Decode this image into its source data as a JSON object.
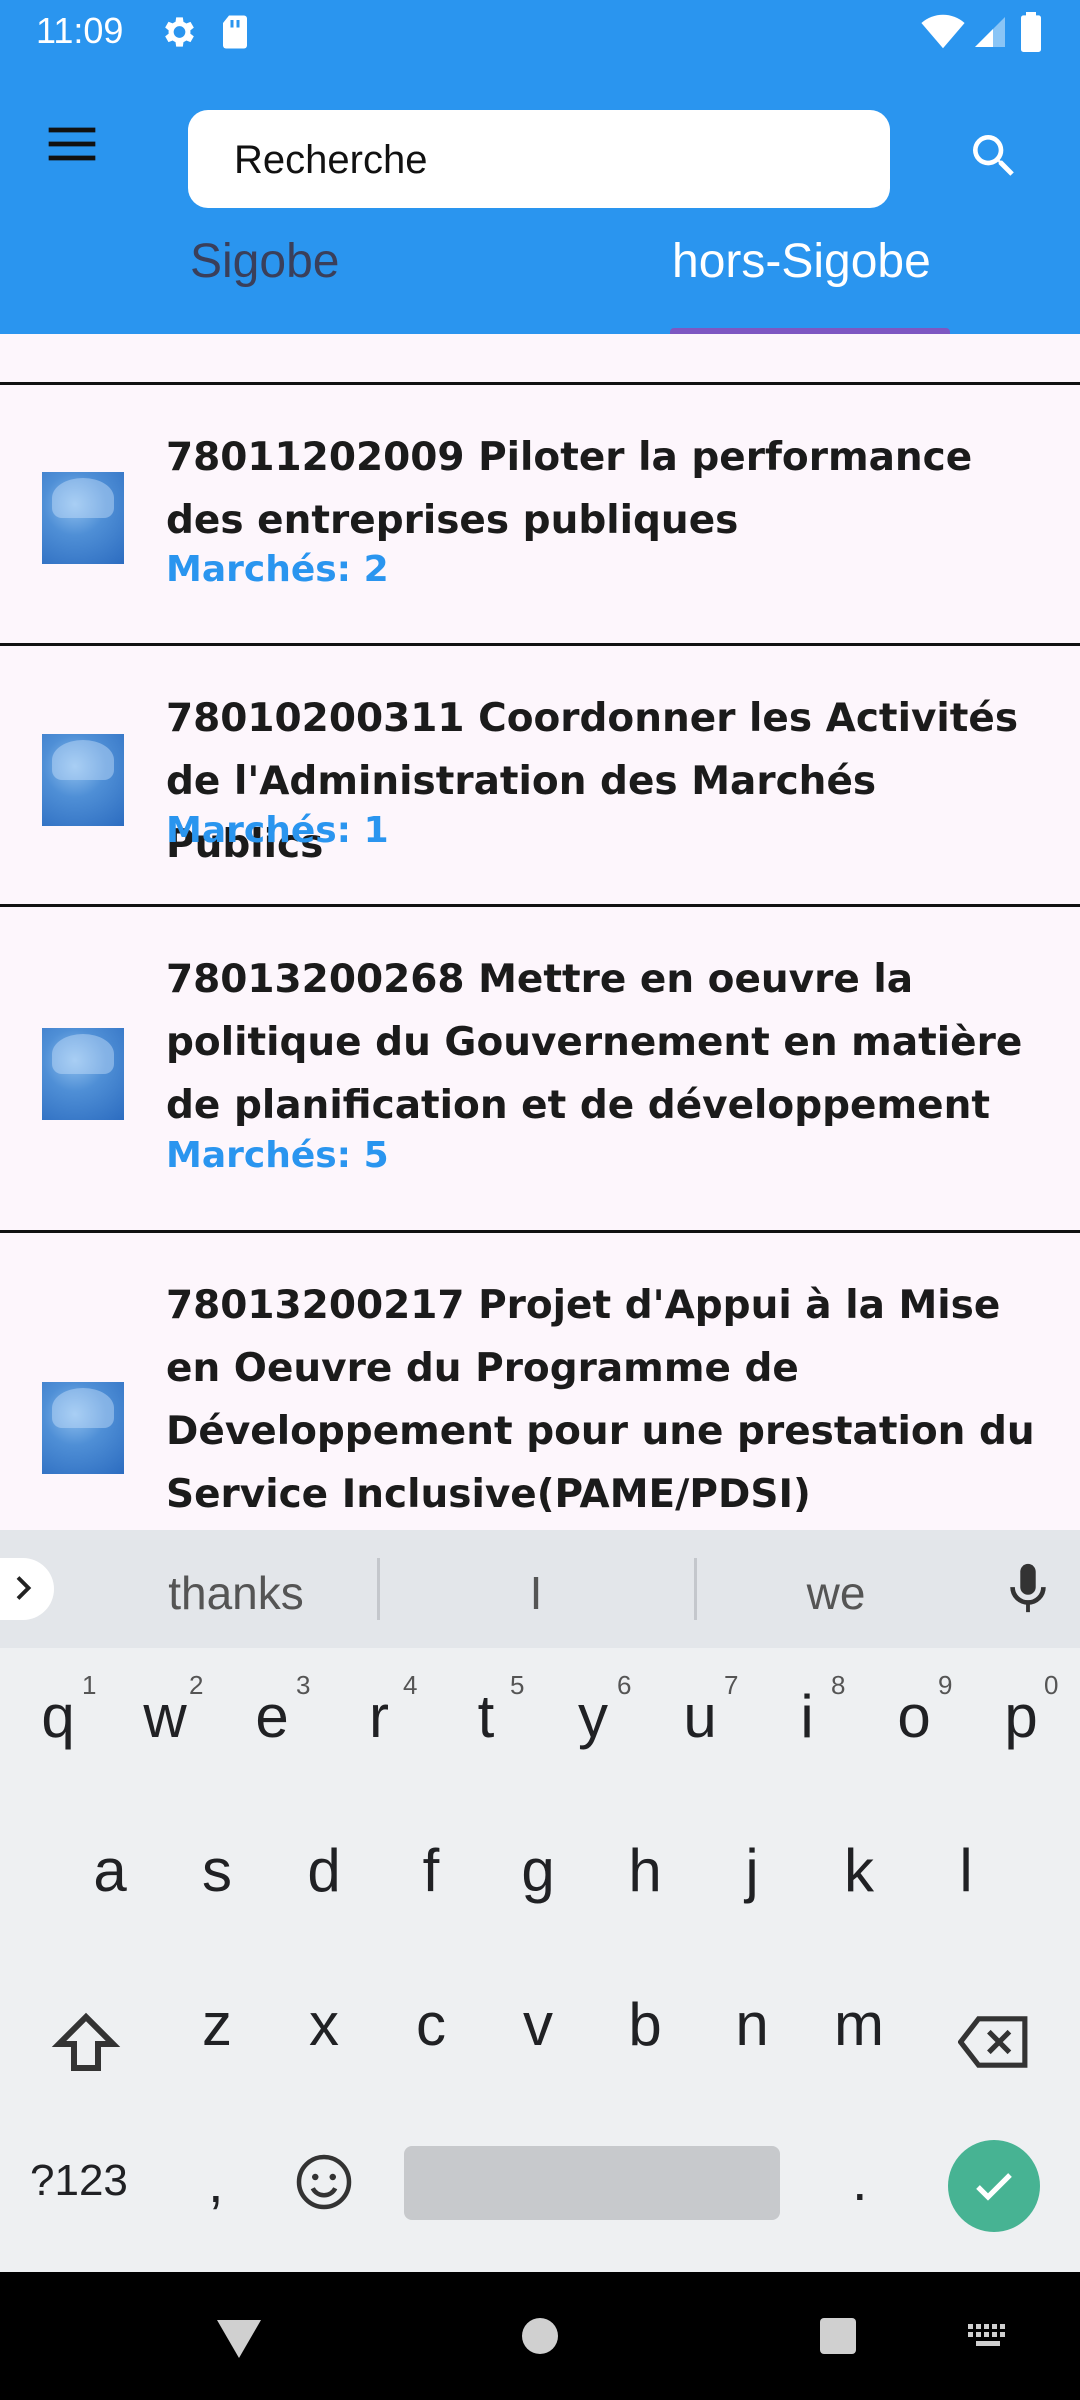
{
  "status_bar": {
    "time": "11:09"
  },
  "search": {
    "placeholder": "Recherche"
  },
  "tabs": [
    {
      "label": "Sigobe",
      "selected": false
    },
    {
      "label": "hors-Sigobe",
      "selected": true
    }
  ],
  "items": [
    {
      "title": "78011202009 Piloter la performance des entreprises publiques",
      "count": "Marchés: 2"
    },
    {
      "title": "78010200311 Coordonner les Activités de l'Administration des Marchés Publics",
      "count": "Marchés: 1"
    },
    {
      "title": "78013200268 Mettre en oeuvre la politique du Gouvernement en matière de planification et de développement",
      "count": "Marchés: 5"
    },
    {
      "title": "78013200217 Projet d'Appui à la Mise en Oeuvre du Programme de Développement pour une prestation du Service Inclusive(PAME/PDSI)",
      "count": ""
    }
  ],
  "keyboard": {
    "suggestions": [
      "thanks",
      "I",
      "we"
    ],
    "row1": [
      "q",
      "w",
      "e",
      "r",
      "t",
      "y",
      "u",
      "i",
      "o",
      "p"
    ],
    "row1_hints": [
      "1",
      "2",
      "3",
      "4",
      "5",
      "6",
      "7",
      "8",
      "9",
      "0"
    ],
    "row2": [
      "a",
      "s",
      "d",
      "f",
      "g",
      "h",
      "j",
      "k",
      "l"
    ],
    "row3": [
      "z",
      "x",
      "c",
      "v",
      "b",
      "n",
      "m"
    ],
    "symbols_label": "?123",
    "comma": ",",
    "period": "."
  },
  "colors": {
    "primary": "#2a95ef",
    "tab_indicator": "#7e57c2",
    "enter_key": "#47b393"
  }
}
